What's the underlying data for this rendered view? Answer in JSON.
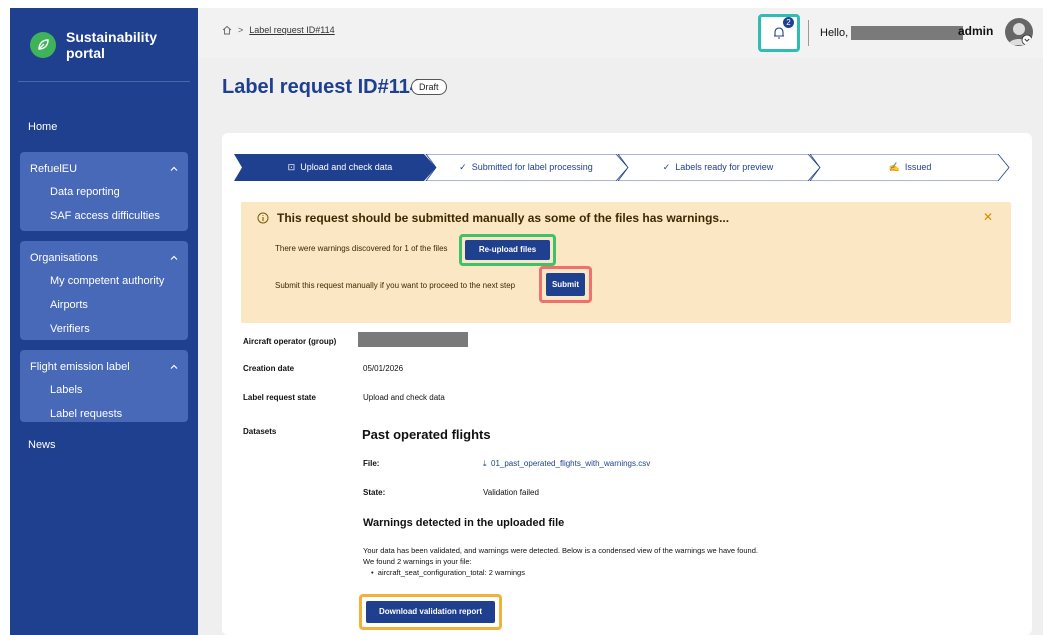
{
  "brand": {
    "name": "Sustainability portal"
  },
  "nav": {
    "home": "Home",
    "news": "News",
    "groups": [
      {
        "title": "RefuelEU",
        "items": [
          "Data reporting",
          "SAF access difficulties"
        ]
      },
      {
        "title": "Organisations",
        "items": [
          "My competent authority",
          "Airports",
          "Verifiers"
        ]
      },
      {
        "title": "Flight emission label",
        "items": [
          "Labels",
          "Label requests"
        ]
      }
    ]
  },
  "topbar": {
    "breadcrumb": "Label request ID#114",
    "notification_count": "2",
    "greeting": "Hello,",
    "user_role": "admin"
  },
  "page": {
    "title": "Label request ID#114",
    "status_badge": "Draft"
  },
  "steps": [
    "Upload and check data",
    "Submitted for label processing",
    "Labels ready for preview",
    "Issued"
  ],
  "warning": {
    "title": "This request should be submitted manually as some of the files has warnings...",
    "line1": "There were warnings discovered for 1 of the files",
    "reupload_label": "Re-upload files",
    "line2": "Submit this request manually if you want to proceed to the next step",
    "submit_label": "Submit"
  },
  "details": {
    "operator_label": "Aircraft operator (group)",
    "creation_label": "Creation date",
    "creation_value": "05/01/2026",
    "state_label": "Label request state",
    "state_value": "Upload and check data",
    "datasets_label": "Datasets"
  },
  "dataset": {
    "title": "Past operated flights",
    "file_label": "File:",
    "file_name": "01_past_operated_flights_with_warnings.csv",
    "state_label": "State:",
    "state_value": "Validation failed",
    "warnings_title": "Warnings detected in the uploaded file",
    "para1": "Your data has been validated, and warnings were detected. Below is a condensed view of the warnings we have found.",
    "para2": "We found 2 warnings in your file:",
    "bullet": "aircraft_seat_configuration_total: 2 warnings",
    "download_label": "Download validation report"
  }
}
